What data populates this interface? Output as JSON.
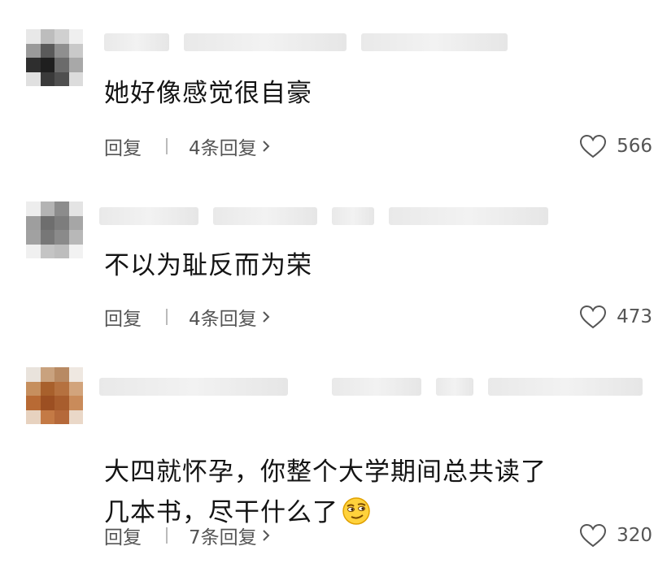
{
  "comments": [
    {
      "text": "她好像感觉很自豪",
      "reply_label": "回复",
      "thread_label": "4条回复",
      "likes": "566"
    },
    {
      "text": "不以为耻反而为荣",
      "reply_label": "回复",
      "thread_label": "4条回复",
      "likes": "473"
    },
    {
      "text": "大四就怀孕，你整个大学期间总共读了\n几本书，尽干什么了",
      "reply_label": "回复",
      "thread_label": "7条回复",
      "likes": "320",
      "emoji": "smirk-emoji"
    }
  ],
  "icons": {
    "chevron": "chevron-right-icon",
    "like": "heart-icon"
  },
  "colors": {
    "text": "#141414",
    "secondary": "#555555",
    "separator": "#bbbbbb"
  }
}
